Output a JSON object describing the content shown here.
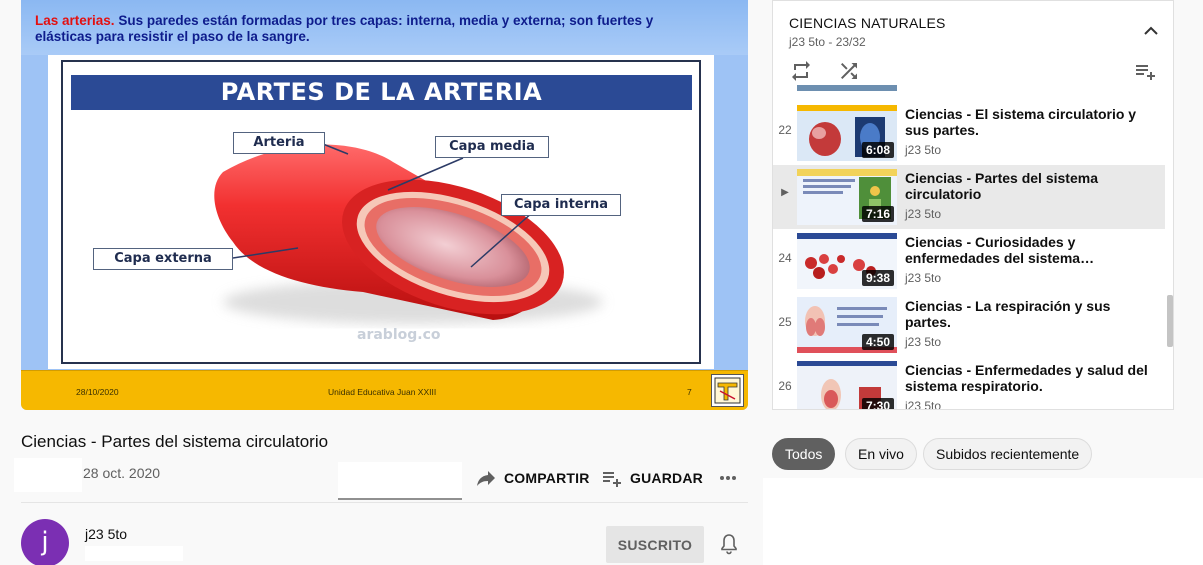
{
  "slide": {
    "intro_lead": "Las arterias.",
    "intro_text": " Sus paredes están formadas por tres capas: interna,  media y externa; son fuertes y elásticas para resistir el paso de la sangre.",
    "title": "PARTES DE LA ARTERIA",
    "labels": {
      "arteria": "Arteria",
      "capa_media": "Capa media",
      "capa_interna": "Capa interna",
      "capa_externa": "Capa externa"
    },
    "watermark": "arablog.co",
    "footer_date": "28/10/2020",
    "footer_school": "Unidad Educativa Juan XXIII",
    "footer_page": "7"
  },
  "video": {
    "title": "Ciencias - Partes del sistema circulatorio",
    "upload_date": "28 oct. 2020",
    "share_label": "COMPARTIR",
    "save_label": "GUARDAR"
  },
  "channel": {
    "avatar_letter": "j",
    "name": "j23 5to",
    "subscribed_label": "SUSCRITO"
  },
  "playlist": {
    "title": "CIENCIAS NATURALES",
    "meta": "j23 5to - 23/32",
    "items": [
      {
        "index": "22",
        "title": "Ciencias - El sistema circulatorio y sus partes.",
        "channel": "j23 5to",
        "duration": "6:08",
        "active": false
      },
      {
        "index": "▶",
        "title": "Ciencias - Partes del sistema circulatorio",
        "channel": "j23 5to",
        "duration": "7:16",
        "active": true
      },
      {
        "index": "24",
        "title": "Ciencias - Curiosidades y enfermedades del sistema…",
        "channel": "j23 5to",
        "duration": "9:38",
        "active": false
      },
      {
        "index": "25",
        "title": "Ciencias - La respiración y sus partes.",
        "channel": "j23 5to",
        "duration": "4:50",
        "active": false
      },
      {
        "index": "26",
        "title": "Ciencias - Enfermedades y salud del sistema respiratorio.",
        "channel": "j23 5to",
        "duration": "7:30",
        "active": false
      }
    ]
  },
  "chips": {
    "all": "Todos",
    "live": "En vivo",
    "recent": "Subidos recientemente"
  },
  "colors": {
    "accent_red": "#e31010",
    "slide_blue": "#2b4a95",
    "footer_yellow": "#f6b800",
    "avatar_purple": "#7b2fb3"
  }
}
